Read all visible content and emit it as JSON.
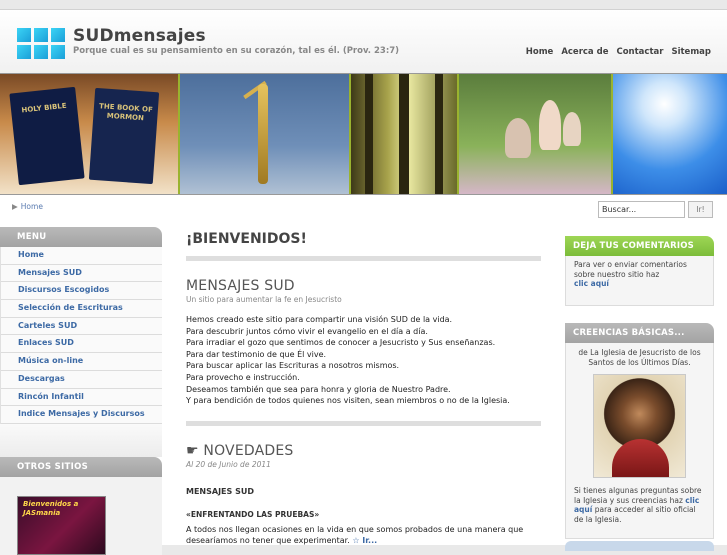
{
  "header": {
    "title": "SUDmensajes",
    "tagline": "Porque cual es su pensamiento en su corazón, tal es él. (Prov. 23:7)",
    "nav": [
      "Home",
      "Acerca de",
      "Contactar",
      "Sitemap"
    ]
  },
  "banner": {
    "book1_label": "HOLY BIBLE",
    "book2_label": "THE BOOK OF MORMON"
  },
  "breadcrumb": {
    "label": "Home"
  },
  "search": {
    "value": "Buscar...",
    "button": "Ir!"
  },
  "sidebar": {
    "menu_title": "MENU",
    "items": [
      "Home",
      "Mensajes SUD",
      "Discursos Escogidos",
      "Selección de Escrituras",
      "Carteles SUD",
      "Enlaces SUD",
      "Música on-line",
      "Descargas",
      "Rincón Infantil",
      "Indice Mensajes y Discursos"
    ],
    "others_title": "OTROS SITIOS",
    "others_image_text": "Bienvenidos a JASmania"
  },
  "main": {
    "welcome": "¡BIENVENIDOS!",
    "section1_title": "MENSAJES SUD",
    "section1_subtitle": "Un sitio para aumentar la fe en Jesucristo",
    "section1_lines": [
      "Hemos creado este sitio para compartir una visión SUD de la vida.",
      "Para descubrir juntos cómo vivir el evangelio en el día a día.",
      "Para irradiar el gozo que sentimos de conocer a Jesucristo y Sus enseñanzas.",
      "Para dar testimonio de que Él vive.",
      "Para buscar aplicar las Escrituras a nosotros mismos.",
      "Para provecho e instrucción.",
      "Deseamos también que sea para honra y gloria de Nuestro Padre.",
      "Y para bendición de todos quienes nos visiten, sean miembros o no de la Iglesia."
    ],
    "news_title": "☛ NOVEDADES",
    "news_date": "Al 20 de Junio de 2011",
    "news_heading": "MENSAJES SUD",
    "news_item_title": "«ENFRENTANDO LAS PRUEBAS»",
    "news_item_text_1": "A todos nos llegan ocasiones en la vida en que somos probados de una manera que",
    "news_item_text_2": "desearíamos no tener que experimentar.",
    "news_item_more": "☆ Ir..."
  },
  "right": {
    "comments_title": "DEJA TUS COMENTARIOS",
    "comments_text": "Para ver o enviar comentarios sobre nuestro sitio haz",
    "comments_link": "clic aquí",
    "beliefs_title": "CREENCIAS BÁSICAS...",
    "beliefs_intro": "de La Iglesia de Jesucristo de los Santos de los Últimos Días.",
    "beliefs_text_1": "Si tienes algunas preguntas sobre la Iglesia y sus creencias haz",
    "beliefs_link": "clic aquí",
    "beliefs_text_2": "para acceder al sitio oficial de la Iglesia."
  }
}
